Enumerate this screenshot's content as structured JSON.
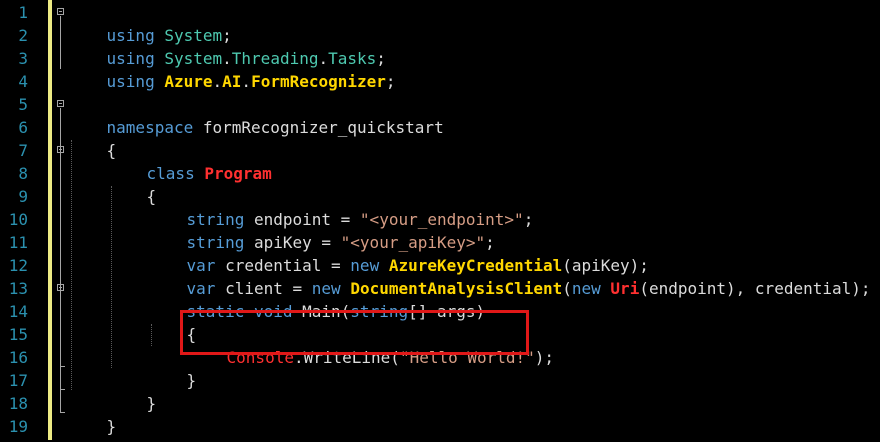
{
  "line_numbers": [
    "1",
    "2",
    "3",
    "4",
    "5",
    "6",
    "7",
    "8",
    "9",
    "10",
    "11",
    "12",
    "13",
    "14",
    "15",
    "16",
    "17",
    "18",
    "19"
  ],
  "lines": {
    "l1": {
      "k1": "using",
      "t1": "System",
      "p1": ";"
    },
    "l2": {
      "k1": "using",
      "t1": "System",
      "d1": ".",
      "t2": "Threading",
      "d2": ".",
      "t3": "Tasks",
      "p1": ";"
    },
    "l3": {
      "k1": "using",
      "t1": "Azure",
      "d1": ".",
      "t2": "AI",
      "d2": ".",
      "t3": "FormRecognizer",
      "p1": ";"
    },
    "l5": {
      "k1": "namespace",
      "p1": "formRecognizer_quickstart"
    },
    "l6": {
      "p1": "{"
    },
    "l7": {
      "k1": "class",
      "c1": "Program"
    },
    "l8": {
      "p1": "{"
    },
    "l9": {
      "k1": "string",
      "p1": " endpoint = ",
      "s1": "\"<your_endpoint>\"",
      "p2": ";"
    },
    "l10": {
      "k1": "string",
      "p1": " apiKey = ",
      "s1": "\"<your_apiKey>\"",
      "p2": ";"
    },
    "l11": {
      "k1": "var",
      "p1": " credential = ",
      "k2": "new",
      "c1": "AzureKeyCredential",
      "p2": "(apiKey);"
    },
    "l12": {
      "k1": "var",
      "p1": " client = ",
      "k2": "new",
      "c1": "DocumentAnalysisClient",
      "p2": "(",
      "k3": "new",
      "c2": "Uri",
      "p3": "(endpoint), credential);"
    },
    "l13": {
      "k1": "static",
      "k2": "void",
      "p1": " Main(",
      "k3": "string",
      "p2": "[] args)"
    },
    "l14": {
      "p1": "{"
    },
    "l15": {
      "c1": "Console",
      "p1": ".WriteLine(",
      "s1": "\"Hello World!\"",
      "p2": ");"
    },
    "l16": {
      "p1": "}"
    },
    "l17": {
      "p1": "}"
    },
    "l18": {
      "p1": "}"
    }
  },
  "colors": {
    "background": "#000000",
    "line_number": "#2b91af",
    "keyword": "#569cd6",
    "type": "#4ec9b0",
    "class_red": "#ff3030",
    "class_yellow": "#ffd700",
    "string": "#d69d85",
    "text": "#dcdcdc",
    "highlight_border": "#e01818",
    "change_bar": "#eeeb84"
  }
}
